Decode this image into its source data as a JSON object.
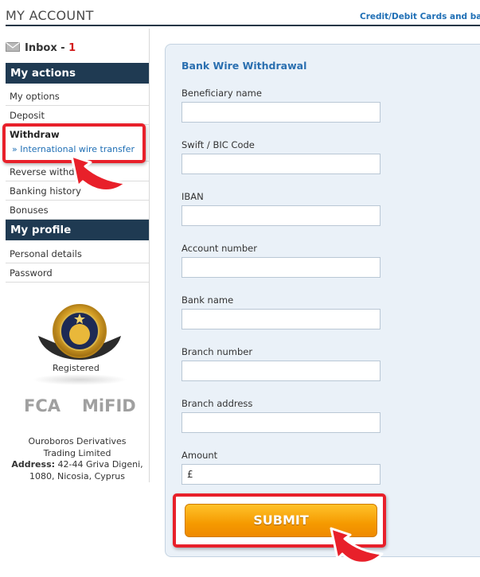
{
  "header": {
    "title": "MY ACCOUNT",
    "link": "Credit/Debit Cards and bar"
  },
  "sidebar": {
    "inbox_label": "Inbox",
    "inbox_sep": " - ",
    "inbox_count": "1",
    "my_actions": "My actions",
    "actions": [
      {
        "label": "My options"
      },
      {
        "label": "Deposit"
      },
      {
        "label": "Reverse withd"
      },
      {
        "label": "Banking history"
      },
      {
        "label": "Bonuses"
      }
    ],
    "withdraw_label": "Withdraw",
    "withdraw_sub": "» International wire transfer",
    "my_profile": "My profile",
    "profile": [
      {
        "label": "Personal details"
      },
      {
        "label": "Password"
      }
    ],
    "registered": "Registered",
    "fca": "FCA",
    "mifid": "MiFID",
    "company_line1": "Ouroboros Derivatives",
    "company_line2": "Trading Limited",
    "address_label": "Address:",
    "address_line1": " 42-44 Griva Digeni,",
    "address_line2": "1080, Nicosia, Cyprus"
  },
  "form": {
    "title": "Bank Wire Withdrawal",
    "fields": [
      {
        "label": "Beneficiary name",
        "value": ""
      },
      {
        "label": "Swift / BIC Code",
        "value": ""
      },
      {
        "label": "IBAN",
        "value": ""
      },
      {
        "label": "Account number",
        "value": ""
      },
      {
        "label": "Bank name",
        "value": ""
      },
      {
        "label": "Branch number",
        "value": ""
      },
      {
        "label": "Branch address",
        "value": ""
      },
      {
        "label": "Amount",
        "value": "£"
      }
    ],
    "submit_label": "SUBMIT"
  },
  "colors": {
    "nav_header": "#1f3a52",
    "link_blue": "#1f6fb5",
    "highlight_red": "#e8202a",
    "submit_orange": "#f59a00"
  }
}
